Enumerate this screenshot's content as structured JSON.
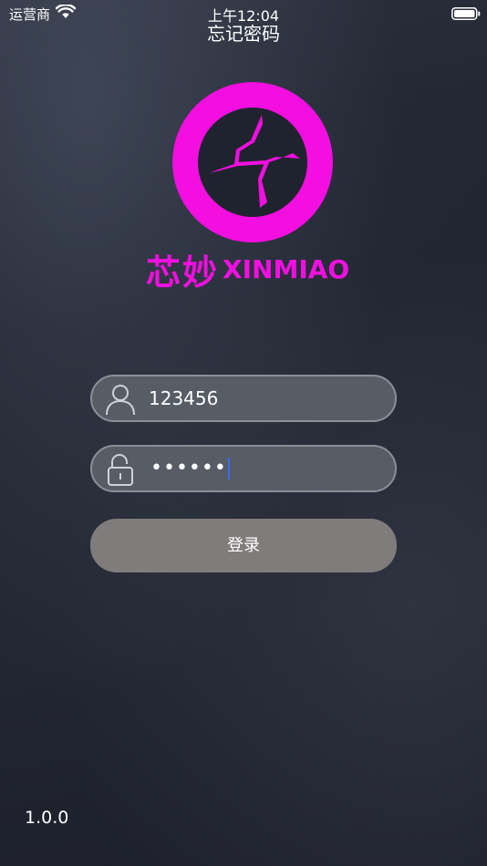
{
  "status_bar": {
    "carrier": "运营商",
    "time": "上午12:04",
    "icons": [
      "wifi-icon",
      "battery-icon"
    ]
  },
  "header": {
    "forgot_password_label": "忘记密码"
  },
  "logo": {
    "icon": "xinmiao-logo-icon",
    "text_cn": "芯妙",
    "text_en": "XINMIAO",
    "color": "#f20fe0"
  },
  "form": {
    "username": {
      "icon": "user-icon",
      "value": "123456"
    },
    "password": {
      "icon": "unlock-icon",
      "masked_value": "••••••"
    },
    "login_label": "登录"
  },
  "footer": {
    "version": "1.0.0"
  },
  "colors": {
    "accent": "#f20fe0",
    "field_background": "#575c65",
    "field_border": "#8a8f98",
    "button_background": "#807c7b",
    "caret": "#3a6df0"
  }
}
